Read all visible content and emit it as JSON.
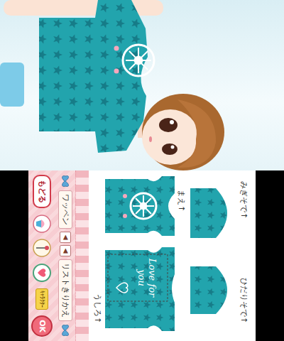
{
  "pattern_pieces": [
    {
      "label": "みぎそで↑"
    },
    {
      "label": "ひだりそで↑"
    },
    {
      "label": "まえ↑"
    },
    {
      "label": "うしろ↑"
    }
  ],
  "decal": {
    "text": "Love for you"
  },
  "menu": {
    "patch_tab": "ワッペン",
    "arrows": [
      "◀",
      "◀"
    ],
    "list_toggle": "リストきりかえ",
    "back": "もどる",
    "character": "ｷｬﾗｸﾀｰ",
    "ok": "OK"
  }
}
